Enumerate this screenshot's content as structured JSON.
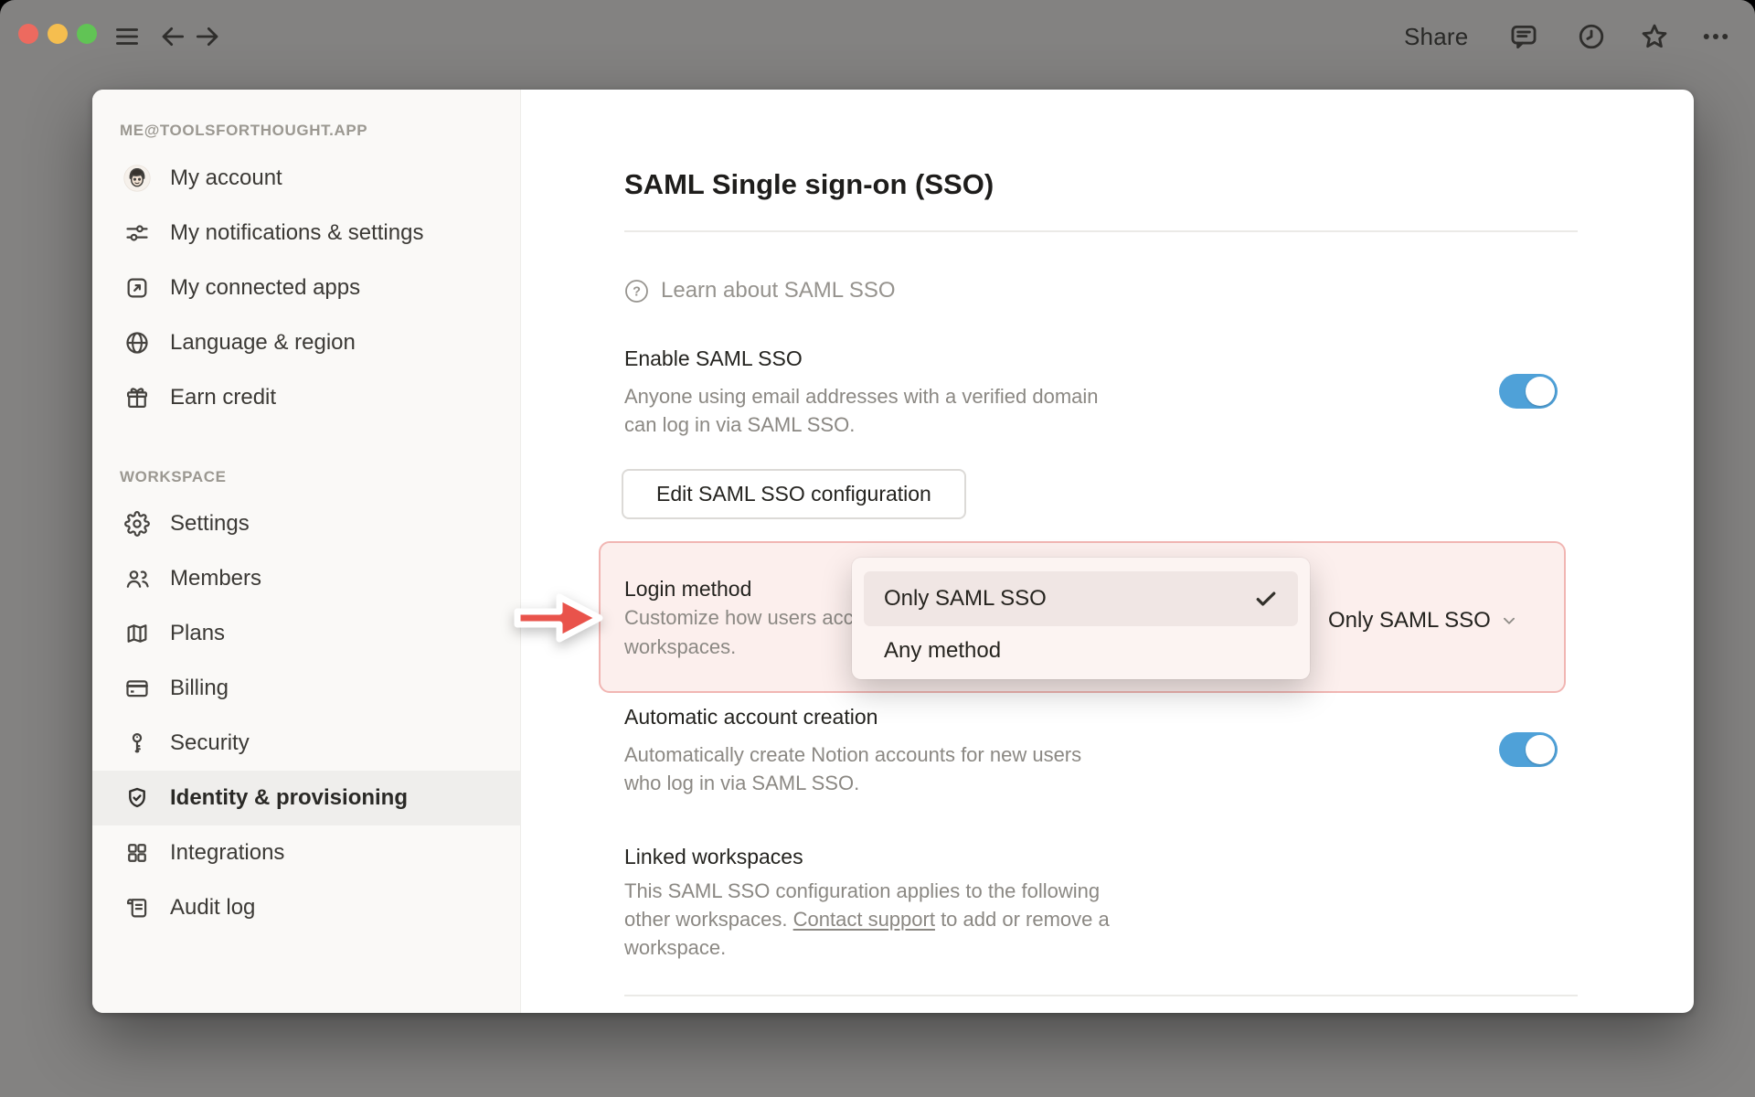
{
  "topbar": {
    "share_label": "Share"
  },
  "sidebar": {
    "account_header": "ME@TOOLSFORTHOUGHT.APP",
    "items": {
      "account": "My account",
      "notifications": "My notifications & settings",
      "connected_apps": "My connected apps",
      "language": "Language & region",
      "earn_credit": "Earn credit"
    },
    "workspace_header": "WORKSPACE",
    "workspace_items": {
      "settings": "Settings",
      "members": "Members",
      "plans": "Plans",
      "billing": "Billing",
      "security": "Security",
      "identity": "Identity & provisioning",
      "integrations": "Integrations",
      "audit": "Audit log"
    }
  },
  "main": {
    "title": "SAML Single sign-on (SSO)",
    "learn_link": "Learn about SAML SSO",
    "learn_icon_glyph": "?",
    "enable_sso": {
      "title": "Enable SAML SSO",
      "description": "Anyone using email addresses with a verified domain can log in via SAML SSO.",
      "toggle": "on"
    },
    "edit_button_label": "Edit SAML SSO configuration",
    "login_method": {
      "title": "Login method",
      "description": "Customize how users access your workspaces.",
      "selected_value": "Only SAML SSO"
    },
    "login_dropdown": {
      "option_only_saml": "Only SAML SSO",
      "option_any": "Any method",
      "checked_option": "Only SAML SSO"
    },
    "auto_account": {
      "title": "Automatic account creation",
      "description": "Automatically create Notion accounts for new users who log in via SAML SSO.",
      "toggle": "on"
    },
    "linked_workspaces": {
      "title": "Linked workspaces",
      "description_before": "This SAML SSO configuration applies to the following other workspaces. ",
      "link_label": "Contact support",
      "description_after": " to add or remove a workspace."
    }
  },
  "colors": {
    "toggle_on_blue": "#4FA1D8",
    "highlight_bg": "#FCEFED",
    "highlight_border": "#F1B6B3",
    "arrow_red": "#E9534B",
    "traffic_red": "#ED6A5F",
    "traffic_yellow": "#F5BE4F",
    "traffic_green": "#61C455"
  }
}
